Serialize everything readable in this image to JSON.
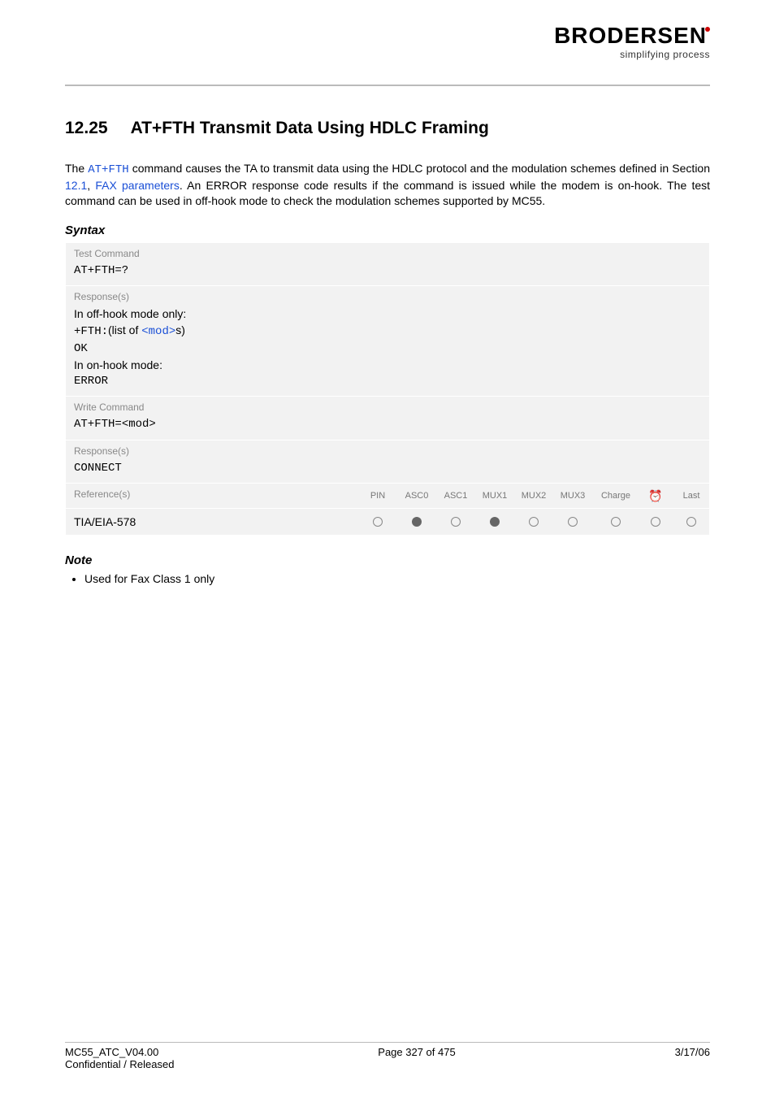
{
  "logo": {
    "brand": "BRODERSEN",
    "tagline": "simplifying process"
  },
  "section": {
    "number": "12.25",
    "title": "AT+FTH   Transmit Data Using HDLC Framing"
  },
  "intro": {
    "pre": "The ",
    "cmd": "AT+FTH",
    "mid1": " command causes the TA to transmit data using the HDLC protocol and the modulation schemes defined in Section ",
    "link1": "12.1",
    "comma": ", ",
    "link2": "FAX parameters",
    "post": ". An ERROR response code results if the command is issued while the modem is on-hook. The test command can be used in off-hook mode to check the modulation schemes supported by MC55."
  },
  "labels": {
    "syntax": "Syntax",
    "note": "Note"
  },
  "box": {
    "test_hdr": "Test Command",
    "test_cmd": "AT+FTH=?",
    "resp_hdr": "Response(s)",
    "resp_line1": "In off-hook mode only:",
    "resp_fth": "+FTH:",
    "resp_listof_pre": "(list of ",
    "resp_mod": "<mod>",
    "resp_listof_post": "s)",
    "resp_ok": "OK",
    "resp_line2": "In on-hook mode:",
    "resp_err": "ERROR",
    "write_hdr": "Write Command",
    "write_cmd_pre": "AT+FTH=",
    "write_cmd_mod": "<mod>",
    "write_resp_hdr": "Response(s)",
    "write_resp": "CONNECT",
    "ref_hdr": "Reference(s)",
    "ref_val": "TIA/EIA-578",
    "cols": [
      "PIN",
      "ASC0",
      "ASC1",
      "MUX1",
      "MUX2",
      "MUX3",
      "Charge",
      "⏰",
      "Last"
    ],
    "dots": [
      "open",
      "filled",
      "open",
      "filled",
      "open",
      "open",
      "open",
      "open",
      "open"
    ]
  },
  "note_item": "Used for Fax Class 1 only",
  "footer": {
    "left1": "MC55_ATC_V04.00",
    "center": "Page 327 of 475",
    "right": "3/17/06",
    "left2": "Confidential / Released"
  }
}
